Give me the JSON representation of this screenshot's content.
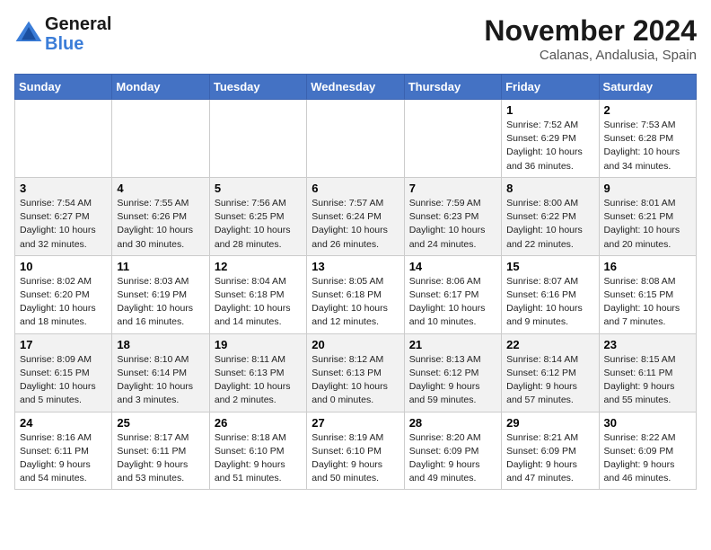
{
  "logo": {
    "line1": "General",
    "line2": "Blue"
  },
  "title": "November 2024",
  "location": "Calanas, Andalusia, Spain",
  "weekdays": [
    "Sunday",
    "Monday",
    "Tuesday",
    "Wednesday",
    "Thursday",
    "Friday",
    "Saturday"
  ],
  "weeks": [
    [
      {
        "day": "",
        "info": ""
      },
      {
        "day": "",
        "info": ""
      },
      {
        "day": "",
        "info": ""
      },
      {
        "day": "",
        "info": ""
      },
      {
        "day": "",
        "info": ""
      },
      {
        "day": "1",
        "info": "Sunrise: 7:52 AM\nSunset: 6:29 PM\nDaylight: 10 hours and 36 minutes."
      },
      {
        "day": "2",
        "info": "Sunrise: 7:53 AM\nSunset: 6:28 PM\nDaylight: 10 hours and 34 minutes."
      }
    ],
    [
      {
        "day": "3",
        "info": "Sunrise: 7:54 AM\nSunset: 6:27 PM\nDaylight: 10 hours and 32 minutes."
      },
      {
        "day": "4",
        "info": "Sunrise: 7:55 AM\nSunset: 6:26 PM\nDaylight: 10 hours and 30 minutes."
      },
      {
        "day": "5",
        "info": "Sunrise: 7:56 AM\nSunset: 6:25 PM\nDaylight: 10 hours and 28 minutes."
      },
      {
        "day": "6",
        "info": "Sunrise: 7:57 AM\nSunset: 6:24 PM\nDaylight: 10 hours and 26 minutes."
      },
      {
        "day": "7",
        "info": "Sunrise: 7:59 AM\nSunset: 6:23 PM\nDaylight: 10 hours and 24 minutes."
      },
      {
        "day": "8",
        "info": "Sunrise: 8:00 AM\nSunset: 6:22 PM\nDaylight: 10 hours and 22 minutes."
      },
      {
        "day": "9",
        "info": "Sunrise: 8:01 AM\nSunset: 6:21 PM\nDaylight: 10 hours and 20 minutes."
      }
    ],
    [
      {
        "day": "10",
        "info": "Sunrise: 8:02 AM\nSunset: 6:20 PM\nDaylight: 10 hours and 18 minutes."
      },
      {
        "day": "11",
        "info": "Sunrise: 8:03 AM\nSunset: 6:19 PM\nDaylight: 10 hours and 16 minutes."
      },
      {
        "day": "12",
        "info": "Sunrise: 8:04 AM\nSunset: 6:18 PM\nDaylight: 10 hours and 14 minutes."
      },
      {
        "day": "13",
        "info": "Sunrise: 8:05 AM\nSunset: 6:18 PM\nDaylight: 10 hours and 12 minutes."
      },
      {
        "day": "14",
        "info": "Sunrise: 8:06 AM\nSunset: 6:17 PM\nDaylight: 10 hours and 10 minutes."
      },
      {
        "day": "15",
        "info": "Sunrise: 8:07 AM\nSunset: 6:16 PM\nDaylight: 10 hours and 9 minutes."
      },
      {
        "day": "16",
        "info": "Sunrise: 8:08 AM\nSunset: 6:15 PM\nDaylight: 10 hours and 7 minutes."
      }
    ],
    [
      {
        "day": "17",
        "info": "Sunrise: 8:09 AM\nSunset: 6:15 PM\nDaylight: 10 hours and 5 minutes."
      },
      {
        "day": "18",
        "info": "Sunrise: 8:10 AM\nSunset: 6:14 PM\nDaylight: 10 hours and 3 minutes."
      },
      {
        "day": "19",
        "info": "Sunrise: 8:11 AM\nSunset: 6:13 PM\nDaylight: 10 hours and 2 minutes."
      },
      {
        "day": "20",
        "info": "Sunrise: 8:12 AM\nSunset: 6:13 PM\nDaylight: 10 hours and 0 minutes."
      },
      {
        "day": "21",
        "info": "Sunrise: 8:13 AM\nSunset: 6:12 PM\nDaylight: 9 hours and 59 minutes."
      },
      {
        "day": "22",
        "info": "Sunrise: 8:14 AM\nSunset: 6:12 PM\nDaylight: 9 hours and 57 minutes."
      },
      {
        "day": "23",
        "info": "Sunrise: 8:15 AM\nSunset: 6:11 PM\nDaylight: 9 hours and 55 minutes."
      }
    ],
    [
      {
        "day": "24",
        "info": "Sunrise: 8:16 AM\nSunset: 6:11 PM\nDaylight: 9 hours and 54 minutes."
      },
      {
        "day": "25",
        "info": "Sunrise: 8:17 AM\nSunset: 6:11 PM\nDaylight: 9 hours and 53 minutes."
      },
      {
        "day": "26",
        "info": "Sunrise: 8:18 AM\nSunset: 6:10 PM\nDaylight: 9 hours and 51 minutes."
      },
      {
        "day": "27",
        "info": "Sunrise: 8:19 AM\nSunset: 6:10 PM\nDaylight: 9 hours and 50 minutes."
      },
      {
        "day": "28",
        "info": "Sunrise: 8:20 AM\nSunset: 6:09 PM\nDaylight: 9 hours and 49 minutes."
      },
      {
        "day": "29",
        "info": "Sunrise: 8:21 AM\nSunset: 6:09 PM\nDaylight: 9 hours and 47 minutes."
      },
      {
        "day": "30",
        "info": "Sunrise: 8:22 AM\nSunset: 6:09 PM\nDaylight: 9 hours and 46 minutes."
      }
    ]
  ]
}
